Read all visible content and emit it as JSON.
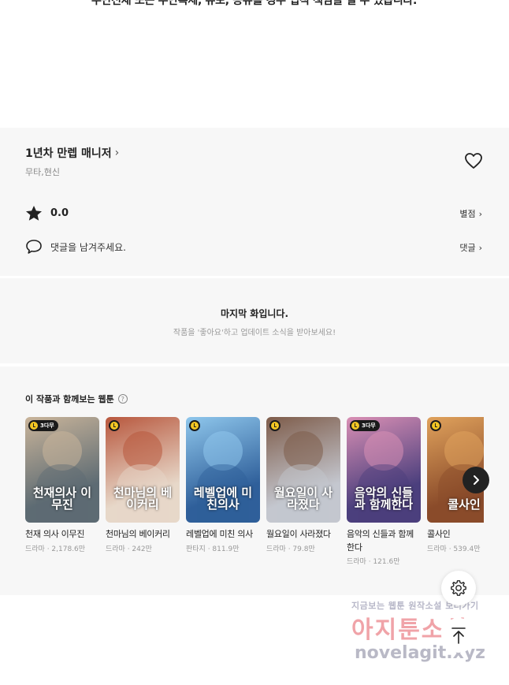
{
  "notice": {
    "text": "무단전재 또는 무단복제, 유포, 공유를 경우 법적 책임을 질 수 있습니다."
  },
  "series": {
    "title": "1년차 만렙 매니저",
    "genre": "무타,현신",
    "rating_value": "0.0",
    "rate_label": "별점",
    "comment_prompt": "댓글을 남겨주세요.",
    "comment_label": "댓글"
  },
  "last_episode": {
    "title": "마지막 화입니다.",
    "subtitle": "작품을 '좋아요'하고 업데이트 소식을 받아보세요!"
  },
  "recommend": {
    "title": "이 작품과 함께보는 웹툰",
    "help_icon": "?",
    "cards": [
      {
        "name": "천재 의사 이무진",
        "meta": "드라마 · 2,178.6만",
        "badge": "3다무",
        "cover": "천재의사 이무진",
        "color": "#5d6b73",
        "accent": "#c9b49a"
      },
      {
        "name": "천마님의 베이커리",
        "meta": "드라마 · 242만",
        "badge": "",
        "cover": "천마님의 베이커리",
        "color": "#e7d8c9",
        "accent": "#b8573d"
      },
      {
        "name": "레벨업에 미친 의사",
        "meta": "판타지 · 811.9만",
        "badge": "",
        "cover": "레벨업에 미친의사",
        "color": "#2f5f9a",
        "accent": "#8fc7ec"
      },
      {
        "name": "월요일이 사라졌다",
        "meta": "드라마 · 79.8만",
        "badge": "",
        "cover": "월요일이 사라졌다",
        "color": "#c4c7cf",
        "accent": "#7e5c4a"
      },
      {
        "name": "음악의 신들과 함께한다",
        "meta": "드라마 · 121.6만",
        "badge": "3다무",
        "cover": "음악의 신들과 함께한다",
        "color": "#4b3f7d",
        "accent": "#d98fb4"
      },
      {
        "name": "콜사인",
        "meta": "드라마 · 539.4만",
        "badge": "",
        "cover": "콜사인",
        "color": "#8a4b2a",
        "accent": "#e0a25c"
      }
    ]
  },
  "watermark": {
    "line1": "지금보는 웹툰 원작소설 보러가기",
    "line2": "아지툰소설",
    "line3": "novelagit.xyz"
  },
  "colors": {
    "panel_bg": "#f7f7f7",
    "badge_yellow": "#f3c623",
    "text": "#222222"
  }
}
